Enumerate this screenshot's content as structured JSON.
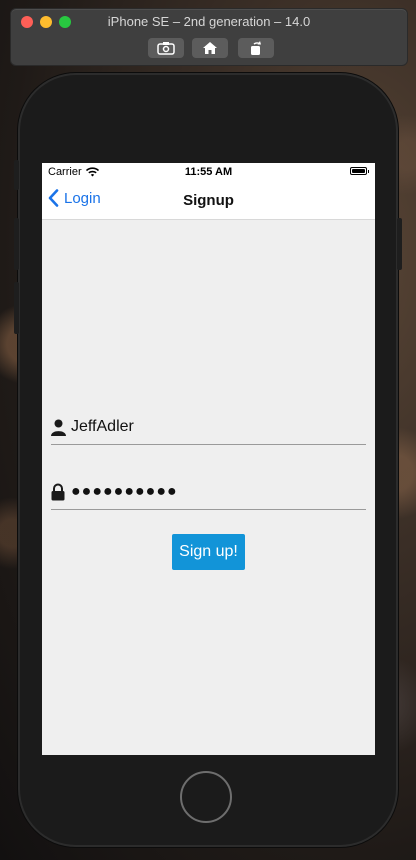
{
  "simulator": {
    "title": "iPhone SE – 2nd generation – 14.0",
    "buttons": [
      "screenshot-icon",
      "home-icon",
      "rotate-icon"
    ]
  },
  "status_bar": {
    "carrier": "Carrier",
    "time": "11:55 AM"
  },
  "nav_bar": {
    "back_label": "Login",
    "title": "Signup"
  },
  "form": {
    "username_value": "JeffAdler",
    "password_masked": "●●●●●●●●●●",
    "signup_label": "Sign up!"
  },
  "colors": {
    "accent": "#1a73e8",
    "button": "#1294d8",
    "screen_bg": "#efefef"
  }
}
